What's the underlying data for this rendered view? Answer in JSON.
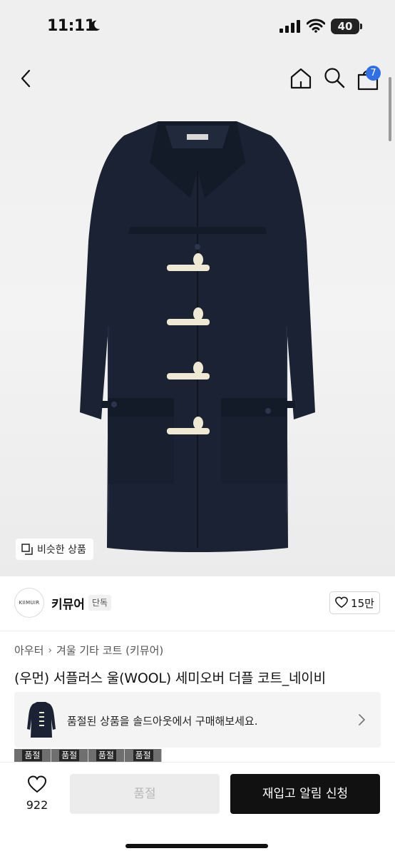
{
  "status_bar": {
    "time": "11:11",
    "battery": "40"
  },
  "nav": {
    "cart_count": "7"
  },
  "product_image": {
    "similar_label": "비슷한 상품",
    "coat_color": "#1a2233",
    "toggle_color": "#efe8d2"
  },
  "brand": {
    "logo_text": "KIIMUIR",
    "name": "키뮤어",
    "tag": "단독",
    "likes": "15만"
  },
  "breadcrumb": [
    "아우터",
    "겨울 기타 코트 (키뮤어)"
  ],
  "product": {
    "title": "(우먼) 서플러스 울(WOOL) 세미오버 더플 코트_네이비"
  },
  "soldout_banner": {
    "text": "품절된 상품을 솔드아웃에서 구매해보세요."
  },
  "option_strip": [
    "품절",
    "품절",
    "품절",
    "품절"
  ],
  "bottom_bar": {
    "wish_count": "922",
    "soldout_label": "품절",
    "restock_label": "재입고 알림 신청"
  },
  "colors": {
    "accent_badge": "#2f6fe8",
    "primary_button": "#111111"
  }
}
